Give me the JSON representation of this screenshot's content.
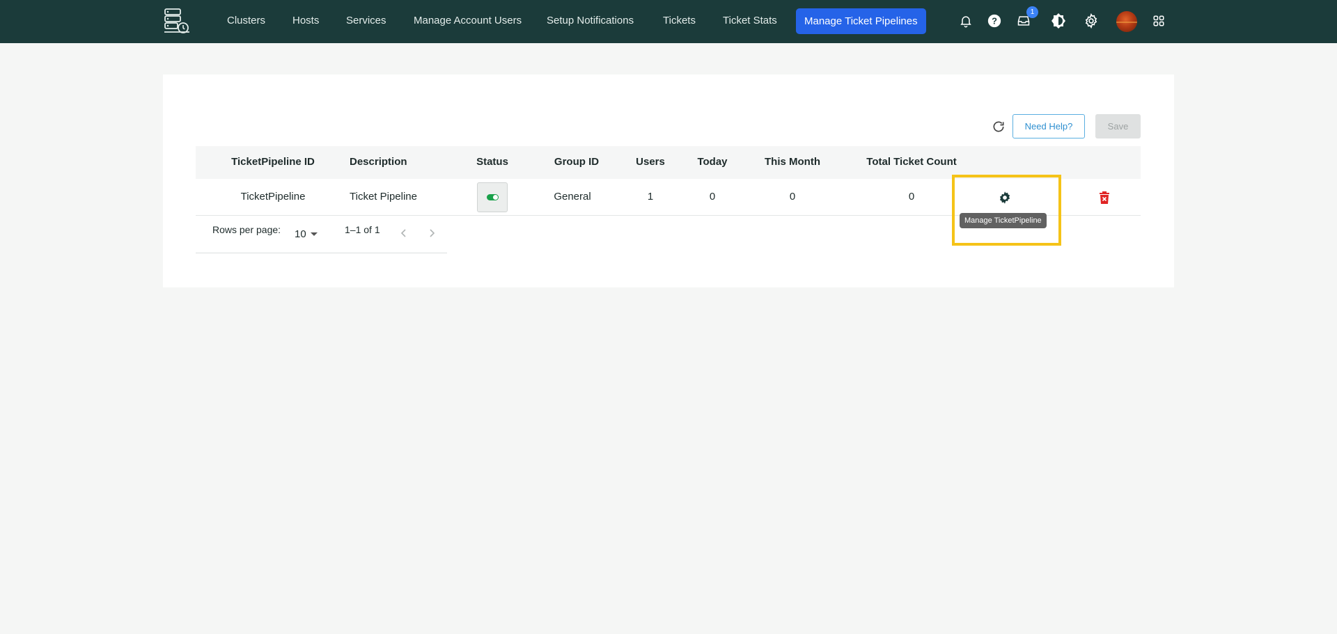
{
  "nav": {
    "items": [
      {
        "label": "Clusters"
      },
      {
        "label": "Hosts"
      },
      {
        "label": "Services"
      },
      {
        "label": "Manage Account Users"
      },
      {
        "label": "Setup Notifications"
      },
      {
        "label": "Tickets"
      },
      {
        "label": "Ticket Stats"
      },
      {
        "label": "Manage Ticket Pipelines",
        "active": true
      }
    ],
    "icons": [
      "bell-icon",
      "help-circle-icon",
      "inbox-icon",
      "theme-toggle-icon",
      "settings-gear-icon",
      "avatar",
      "apps-grid-icon"
    ],
    "inbox_badge": "1",
    "colors": {
      "navbar_bg": "#1b3b3a",
      "active_bg": "#2563e8",
      "badge": "#3b82f6"
    }
  },
  "toolbar": {
    "help_label": "Need Help?",
    "save_label": "Save"
  },
  "table": {
    "columns": [
      "TicketPipeline ID",
      "Description",
      "Status",
      "Group ID",
      "Users",
      "Today",
      "This Month",
      "Total Ticket Count"
    ],
    "rows": [
      {
        "id": "TicketPipeline",
        "description": "Ticket Pipeline",
        "status": "enabled",
        "group_id": "General",
        "users": "1",
        "today": "0",
        "this_month": "0",
        "total": "0"
      }
    ],
    "tooltip": "Manage TicketPipeline"
  },
  "pagination": {
    "rows_per_page_label": "Rows per page:",
    "rows_per_page": "10",
    "range": "1–1 of 1"
  }
}
